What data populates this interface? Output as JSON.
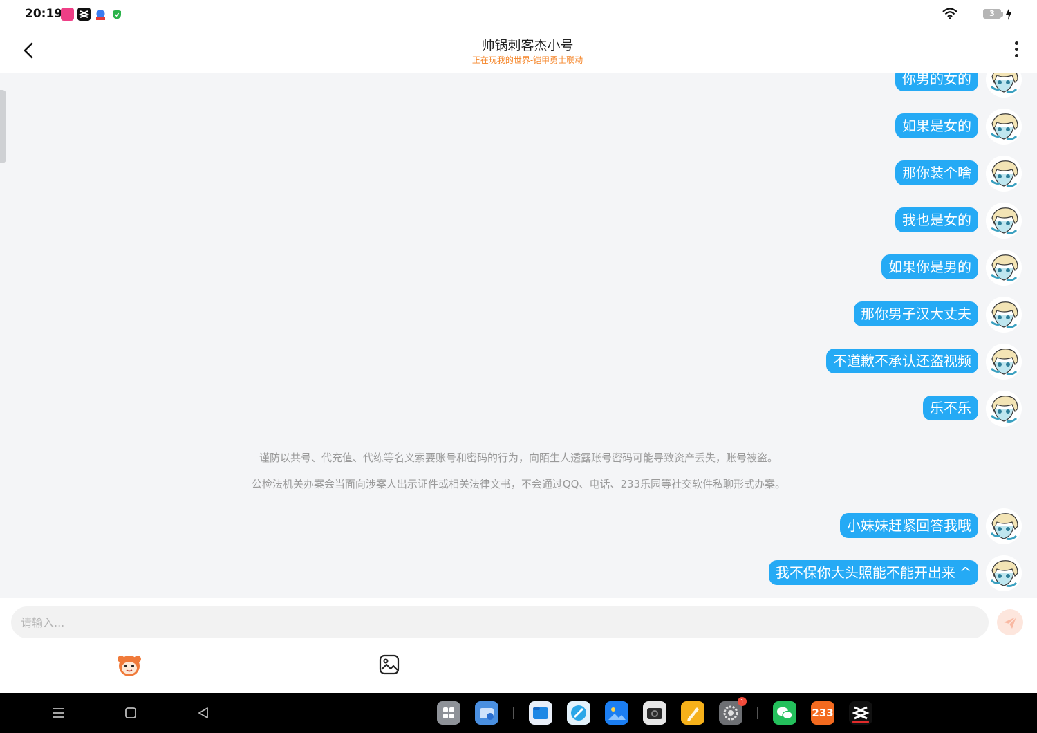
{
  "status_bar": {
    "time": "20:19",
    "battery_level": "3",
    "icons": [
      "app-pink-icon",
      "capcut-icon",
      "baidu-icon",
      "shield-icon",
      "wifi-icon",
      "charging-icon"
    ]
  },
  "header": {
    "title": "帅锅刺客杰小号",
    "subtitle": "正在玩我的世界-铠甲勇士联动",
    "back_icon": "chevron-left-icon",
    "more_icon": "more-vertical-icon"
  },
  "messages_top": [
    {
      "text": "你男的女的",
      "sender": "me"
    },
    {
      "text": "如果是女的",
      "sender": "me"
    },
    {
      "text": "那你装个啥",
      "sender": "me"
    },
    {
      "text": "我也是女的",
      "sender": "me"
    },
    {
      "text": "如果你是男的",
      "sender": "me"
    },
    {
      "text": "那你男子汉大丈夫",
      "sender": "me"
    },
    {
      "text": "不道歉不承认还盗视频",
      "sender": "me"
    },
    {
      "text": "乐不乐",
      "sender": "me"
    }
  ],
  "notices": [
    "谨防以共号、代充值、代练等名义索要账号和密码的行为，向陌生人透露账号密码可能导致资产丢失，账号被盗。",
    "公检法机关办案会当面向涉案人出示证件或相关法律文书，不会通过QQ、电话、233乐园等社交软件私聊形式办案。"
  ],
  "messages_bottom": [
    {
      "text": "小妹妹赶紧回答我哦",
      "sender": "me"
    },
    {
      "text": "我不保你大头照能不能开出来 ^",
      "sender": "me"
    }
  ],
  "composer": {
    "placeholder": "请输入...",
    "value": "",
    "send_icon": "send-icon",
    "emoji_icon": "emoji-mascot-icon",
    "image_icon": "image-icon"
  },
  "taskbar": {
    "nav": [
      "menu-icon",
      "home-icon",
      "back-icon"
    ],
    "dock_apps": [
      {
        "name": "app-drawer-icon",
        "color": "#8e9298"
      },
      {
        "name": "wallet-icon",
        "color": "#4a8fe0"
      },
      {
        "name": "files-icon",
        "color": "#1e88e5"
      },
      {
        "name": "browser-icon",
        "color": "#2aa7e8"
      },
      {
        "name": "gallery-icon",
        "color": "#1b7ef2"
      },
      {
        "name": "camera-icon",
        "color": "#3a3a3a"
      },
      {
        "name": "notes-icon",
        "color": "#f6b11a"
      },
      {
        "name": "settings-icon",
        "color": "#6d6f73",
        "badge": "1"
      },
      {
        "name": "wechat-icon",
        "color": "#24c05c"
      },
      {
        "name": "233-app-icon",
        "label": "233",
        "color": "#f36a1f"
      },
      {
        "name": "capcut-dock-icon",
        "color": "#111111"
      }
    ]
  },
  "colors": {
    "bubble": "#25aaf5",
    "subtitle": "#f5862a",
    "background": "#f4f5f7"
  }
}
